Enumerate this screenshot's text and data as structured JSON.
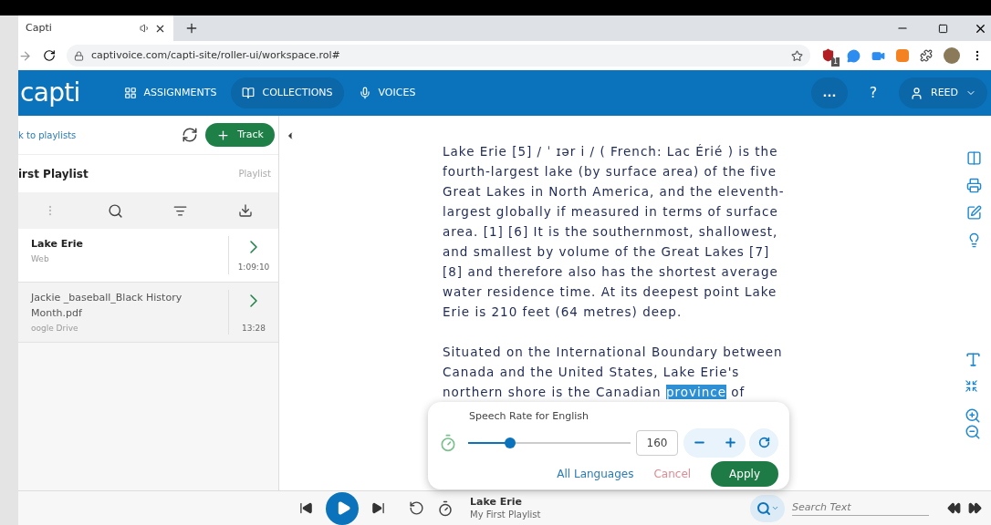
{
  "browser": {
    "tab_title": "Capti",
    "url": "captivoice.com/capti-site/roller-ui/workspace.rol#",
    "extension_badge": "1"
  },
  "app_nav": {
    "logo": "capti",
    "items": [
      {
        "kind": "assignments",
        "label": "ASSIGNMENTS",
        "selected": false
      },
      {
        "kind": "collections",
        "label": "COLLECTIONS",
        "selected": true
      },
      {
        "kind": "voices",
        "label": "VOICES",
        "selected": false
      }
    ],
    "more": "...",
    "help": "?",
    "user": "REED"
  },
  "sidebar": {
    "back_link": "k to playlists",
    "add_button": "Track",
    "playlist_title": "irst Playlist",
    "playlist_label": "Playlist",
    "tracks": [
      {
        "title": "Lake Erie",
        "source": "Web",
        "duration": "1:09:10",
        "selected": true
      },
      {
        "title": "Jackie _baseball_Black History Month.pdf",
        "source": "oogle Drive",
        "duration": "13:28",
        "selected": false
      }
    ]
  },
  "document": {
    "paragraphs": [
      {
        "before": "Lake Erie [5] / ˈ ɪər i / ( French: Lac Érié ) is the fourth-largest lake (by surface area) of the five Great Lakes in North America, and the eleventh-largest globally if measured in terms of surface area. [1] [6] It is the southernmost, shallowest, and smallest by volume of the Great Lakes [7] [8] and therefore also has the shortest average water residence time. At its deepest point Lake Erie is 210 feet (64 metres) deep."
      },
      {
        "before": "Situated on the International Boundary between Canada and the United States, Lake Erie's northern shore is the Canadian ",
        "highlight": "province",
        "after": " of"
      }
    ]
  },
  "speech_rate": {
    "title": "Speech Rate for English",
    "level": 0.26,
    "value": "160",
    "all_languages": "All Languages",
    "cancel": "Cancel",
    "apply": "Apply"
  },
  "player": {
    "track_title": "Lake Erie",
    "playlist": "My First Playlist",
    "search_placeholder": "Search Text"
  }
}
